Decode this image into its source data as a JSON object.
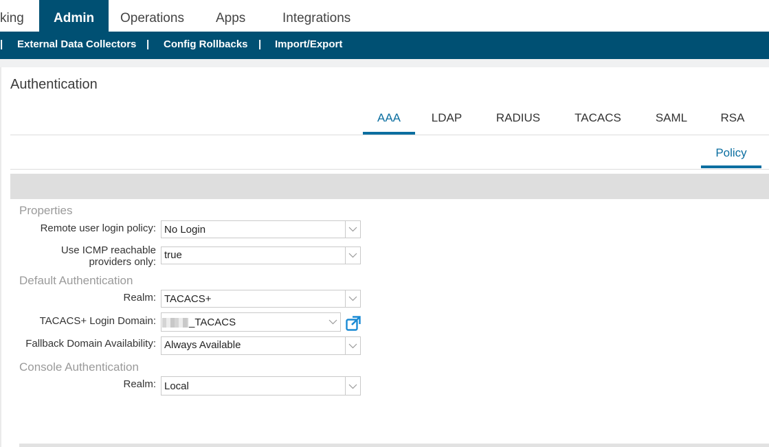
{
  "top_nav": {
    "tabs": [
      {
        "label": "king"
      },
      {
        "label": "Admin"
      },
      {
        "label": "Operations"
      },
      {
        "label": "Apps"
      },
      {
        "label": "Integrations"
      }
    ]
  },
  "sub_nav": {
    "items": [
      "External Data Collectors",
      "Config Rollbacks",
      "Import/Export"
    ],
    "separator": "|"
  },
  "page": {
    "title": "Authentication"
  },
  "tabs": [
    "AAA",
    "LDAP",
    "RADIUS",
    "TACACS",
    "SAML",
    "RSA"
  ],
  "subtabs": [
    "Policy"
  ],
  "form": {
    "properties": {
      "heading": "Properties",
      "remote_login": {
        "label": "Remote user login policy:",
        "value": "No Login"
      },
      "icmp": {
        "label_line1": "Use ICMP reachable",
        "label_line2": "providers only:",
        "value": "true"
      }
    },
    "default_auth": {
      "heading": "Default Authentication",
      "realm": {
        "label": "Realm:",
        "value": "TACACS+"
      },
      "login_domain": {
        "label": "TACACS+ Login Domain:",
        "value": "_TACACS"
      },
      "fallback": {
        "label": "Fallback Domain Availability:",
        "value": "Always Available"
      }
    },
    "console_auth": {
      "heading": "Console Authentication",
      "realm": {
        "label": "Realm:",
        "value": "Local"
      }
    }
  },
  "colors": {
    "nav_blue": "#005073",
    "accent": "#0b6ea0",
    "open_icon": "#1a8ad4"
  },
  "icons": [
    "chevron-down-icon",
    "open-external-icon"
  ]
}
